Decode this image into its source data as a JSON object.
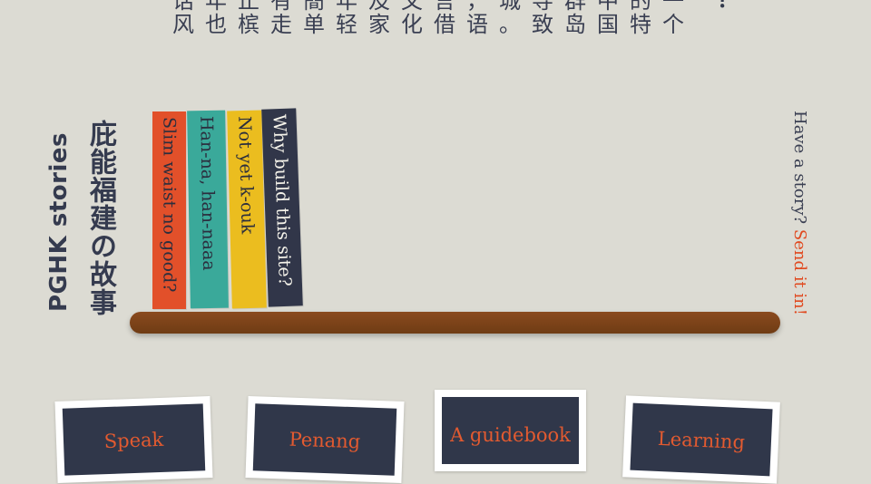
{
  "intro": {
    "line1": "话年止有簡年及文言，城导群中的一",
    "line2": "风也槟走单轻家化借语。致岛国特个",
    "question_mark": "？"
  },
  "shelf_titles": {
    "english": "PGHK stories",
    "chinese": "庇能福建の故事"
  },
  "books": [
    {
      "title": "Slim waist no good?",
      "color": "#e2502a"
    },
    {
      "title": "Han-na, han-naaa",
      "color": "#3aa99a"
    },
    {
      "title": "Not yet k-ouk",
      "color": "#ebbd1f"
    },
    {
      "title": "Why build this site?",
      "color": "#313649"
    }
  ],
  "cta": {
    "text": "Have a story?",
    "link": "Send it in!"
  },
  "cards": [
    {
      "label": "Speak"
    },
    {
      "label": "Penang"
    },
    {
      "label": "A guidebook"
    },
    {
      "label": "Learning"
    }
  ],
  "colors": {
    "background": "#dcdbd3",
    "accent": "#e0491f",
    "navy": "#30374a",
    "shelf": "#7a4218"
  }
}
